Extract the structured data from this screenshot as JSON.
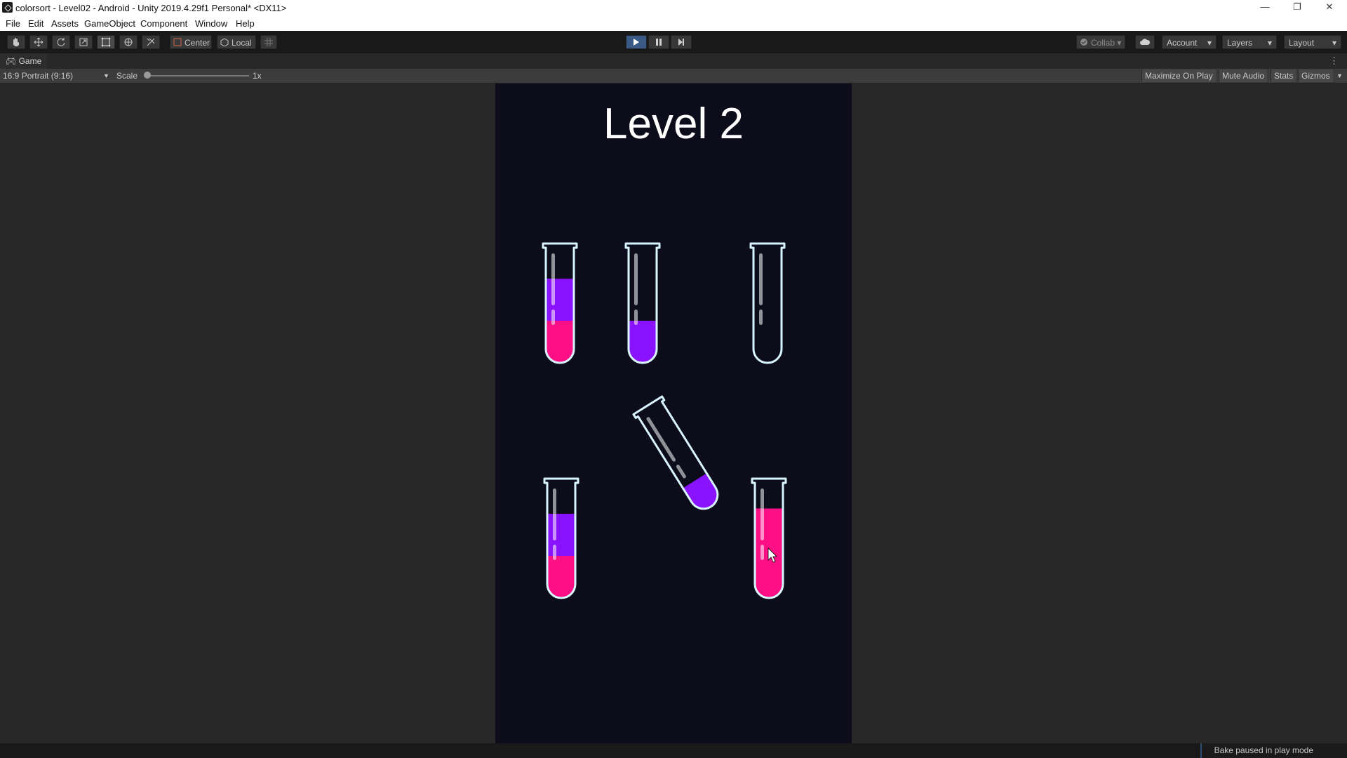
{
  "window": {
    "title": "colorsort - Level02 - Android - Unity 2019.4.29f1 Personal* <DX11>",
    "minimize": "—",
    "restore": "❐",
    "close": "✕"
  },
  "menu": [
    "File",
    "Edit",
    "Assets",
    "GameObject",
    "Component",
    "Window",
    "Help"
  ],
  "toolbar": {
    "tools": [
      "hand-tool",
      "move-tool",
      "rotate-tool",
      "scale-tool",
      "rect-tool",
      "transform-tool",
      "custom-tool"
    ],
    "pivot_label": "Center",
    "space_label": "Local",
    "collab_label": "Collab",
    "account_label": "Account",
    "layers_label": "Layers",
    "layout_label": "Layout",
    "play_color": "#3a5a86"
  },
  "game_tab": {
    "label": "Game",
    "aspect": "16:9 Portrait (9:16)",
    "scale_label": "Scale",
    "scale_value": "1x",
    "maximize_on_play": "Maximize On Play",
    "mute_audio": "Mute Audio",
    "stats": "Stats",
    "gizmos": "Gizmos"
  },
  "game": {
    "level_title": "Level 2",
    "background": "#0c0c1b",
    "colors": {
      "pink": "#ff0f86",
      "purple": "#8a13ff",
      "outline": "#d8f4ff"
    },
    "tubes": [
      {
        "layers": [
          "pink",
          "purple"
        ],
        "fill_fraction": 0.8
      },
      {
        "layers": [
          "purple"
        ],
        "fill_fraction": 0.4
      },
      {
        "layers": [],
        "fill_fraction": 0
      },
      {
        "layers": [
          "purple"
        ],
        "fill_fraction": 0.25,
        "tilted": true
      },
      {
        "layers": [
          "pink",
          "purple"
        ],
        "fill_fraction": 0.8
      },
      {
        "layers": [
          "pink"
        ],
        "fill_fraction": 0.85
      }
    ]
  },
  "status": {
    "message": "Bake paused in play mode"
  }
}
